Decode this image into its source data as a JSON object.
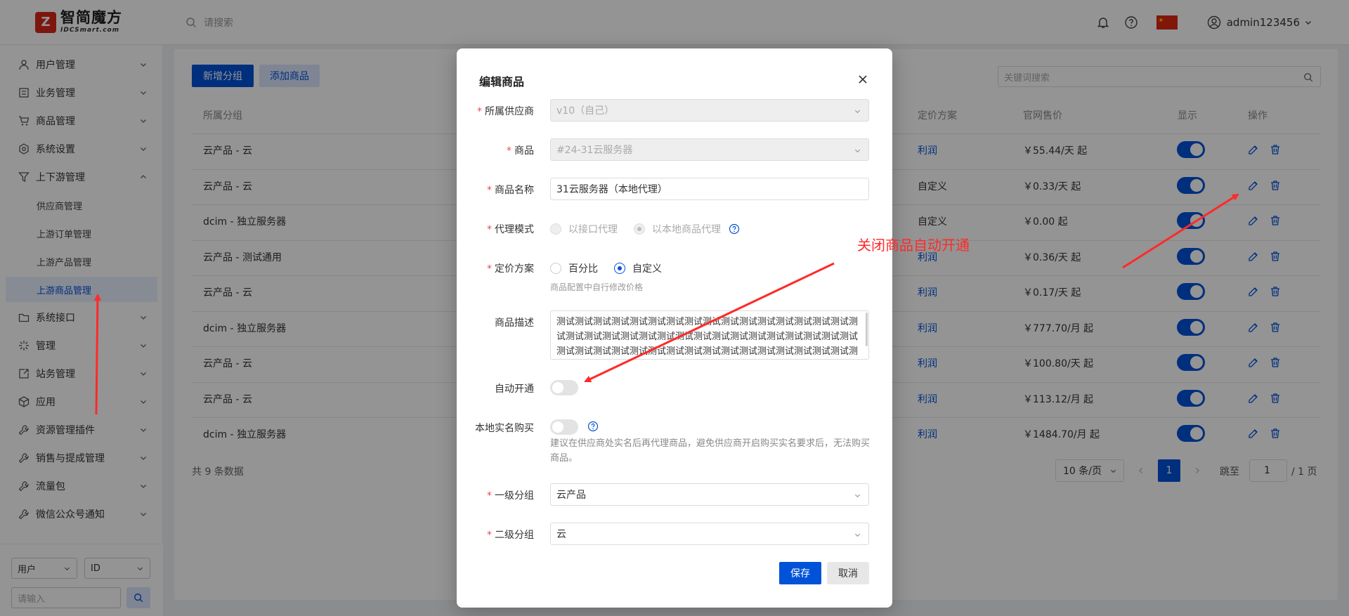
{
  "header": {
    "logo_cn": "智简魔方",
    "logo_en": "IDCSmart.com",
    "search_placeholder": "请搜索",
    "username": "admin123456"
  },
  "sidebar": {
    "items": [
      {
        "label": "用户管理",
        "icon": "user-icon"
      },
      {
        "label": "业务管理",
        "icon": "list-icon"
      },
      {
        "label": "商品管理",
        "icon": "cart-icon"
      },
      {
        "label": "系统设置",
        "icon": "gear-icon"
      },
      {
        "label": "上下游管理",
        "icon": "filter-icon",
        "expanded": true
      },
      {
        "label": "系统接口",
        "icon": "folder-icon"
      },
      {
        "label": "管理",
        "icon": "sparkle-icon"
      },
      {
        "label": "站务管理",
        "icon": "share-icon"
      },
      {
        "label": "应用",
        "icon": "cube-icon"
      },
      {
        "label": "资源管理插件",
        "icon": "wrench-icon"
      },
      {
        "label": "销售与提成管理",
        "icon": "wrench-icon"
      },
      {
        "label": "流量包",
        "icon": "wrench-icon"
      },
      {
        "label": "微信公众号通知",
        "icon": "wrench-icon"
      }
    ],
    "sub_items": [
      "供应商管理",
      "上游订单管理",
      "上游产品管理",
      "上游商品管理"
    ],
    "bottom": {
      "select1": "用户",
      "select2": "ID",
      "input_placeholder": "请输入"
    }
  },
  "toolbar": {
    "add_group": "新增分组",
    "add_product": "添加商品",
    "keyword_placeholder": "关键词搜索"
  },
  "table": {
    "headers": {
      "group": "所属分组",
      "pricing": "定价方案",
      "price": "官网售价",
      "show": "显示",
      "actions": "操作"
    },
    "rows": [
      {
        "group": "云产品 - 云",
        "pricing": "利润",
        "price": "￥55.44/天 起"
      },
      {
        "group": "云产品 - 云",
        "pricing": "自定义",
        "price": "￥0.33/天 起"
      },
      {
        "group": "dcim - 独立服务器",
        "pricing": "自定义",
        "price": "￥0.00 起"
      },
      {
        "group": "云产品 - 测试通用",
        "pricing": "利润",
        "price": "￥0.36/天 起"
      },
      {
        "group": "云产品 - 云",
        "pricing": "利润",
        "price": "￥0.17/天 起"
      },
      {
        "group": "dcim - 独立服务器",
        "pricing": "利润",
        "price": "￥777.70/月 起"
      },
      {
        "group": "云产品 - 云",
        "pricing": "利润",
        "price": "￥100.80/天 起"
      },
      {
        "group": "云产品 - 云",
        "pricing": "利润",
        "price": "￥113.12/月 起"
      },
      {
        "group": "dcim - 独立服务器",
        "pricing": "利润",
        "price": "￥1484.70/月 起"
      }
    ],
    "total": "共 9 条数据"
  },
  "pagination": {
    "page_size": "10 条/页",
    "current": "1",
    "jump_label": "跳至",
    "jump_value": "1",
    "total_pages": "/ 1 页"
  },
  "modal": {
    "title": "编辑商品",
    "supplier_label": "所属供应商",
    "supplier_value": "v10（自己）",
    "product_label": "商品",
    "product_value": "#24-31云服务器",
    "name_label": "商品名称",
    "name_value": "31云服务器（本地代理）",
    "proxy_label": "代理模式",
    "proxy_opt1": "以接口代理",
    "proxy_opt2": "以本地商品代理",
    "pricing_label": "定价方案",
    "pricing_opt1": "百分比",
    "pricing_opt2": "自定义",
    "pricing_hint": "商品配置中自行修改价格",
    "desc_label": "商品描述",
    "desc_value": "测试测试测试测试测试测试测试测试测试测试测试测试测试测试测试测试测试测试测试测试测试测试测试测试测试测试测试测试测试测试测试测试测试测试测试测试测试测试测试测试测试测试测试测试测试测试测试测试测试测试测试测试测试测试测试",
    "auto_label": "自动开通",
    "realname_label": "本地实名购买",
    "realname_hint": "建议在供应商处实名后再代理商品，避免供应商开启购买实名要求后，无法购买商品。",
    "group1_label": "一级分组",
    "group1_value": "云产品",
    "group2_label": "二级分组",
    "group2_value": "云",
    "save": "保存",
    "cancel": "取消"
  },
  "annotation": {
    "text": "关闭商品自动开通",
    "color": "#ff2a2a"
  },
  "colors": {
    "primary": "#0052d9",
    "required": "#e34d59"
  }
}
